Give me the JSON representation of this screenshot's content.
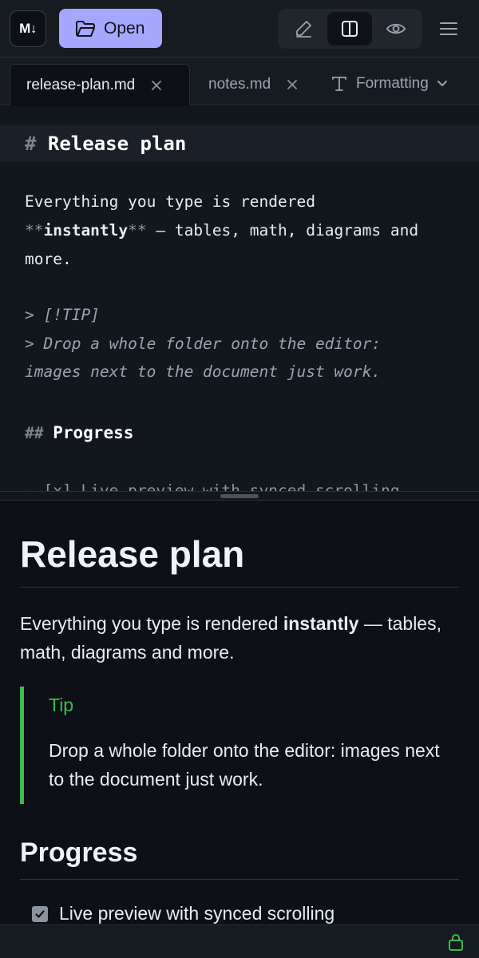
{
  "app": {
    "logo_text": "M↓",
    "open_label": "Open"
  },
  "view_modes": {
    "active": "split",
    "items": [
      "edit",
      "split",
      "preview"
    ]
  },
  "tabs": [
    {
      "label": "release-plan.md",
      "active": true
    },
    {
      "label": "notes.md",
      "active": false
    }
  ],
  "formatting_label": "Formatting",
  "editor": {
    "h1_mark": "#",
    "h1_text": "Release plan",
    "p_line1": "Everything you type is rendered",
    "p_bold_mark_open": "**",
    "p_bold_text": "instantly",
    "p_bold_mark_close": "**",
    "p_line2_rest": " — tables, math, diagrams and",
    "p_line3": "more.",
    "quote_line1": "> [!TIP]",
    "quote_line2": "> Drop a whole folder onto the editor:",
    "quote_line3": "images next to the document just work.",
    "h2_mark": "##",
    "h2_text": "Progress",
    "task_partial": "- [x] Live preview with synced scrolling"
  },
  "preview": {
    "h1": "Release plan",
    "p_before": "Everything you type is rendered ",
    "p_bold": "instantly",
    "p_after": " — tables, math, diagrams and more.",
    "tip_title": "Tip",
    "tip_body": "Drop a whole folder onto the editor: images next to the document just work.",
    "h2": "Progress",
    "task_label": "Live preview with synced scrolling",
    "task_checked": true
  },
  "colors": {
    "accent": "#a5a7ff",
    "tip_green": "#3fb950",
    "background": "#0d1117"
  }
}
